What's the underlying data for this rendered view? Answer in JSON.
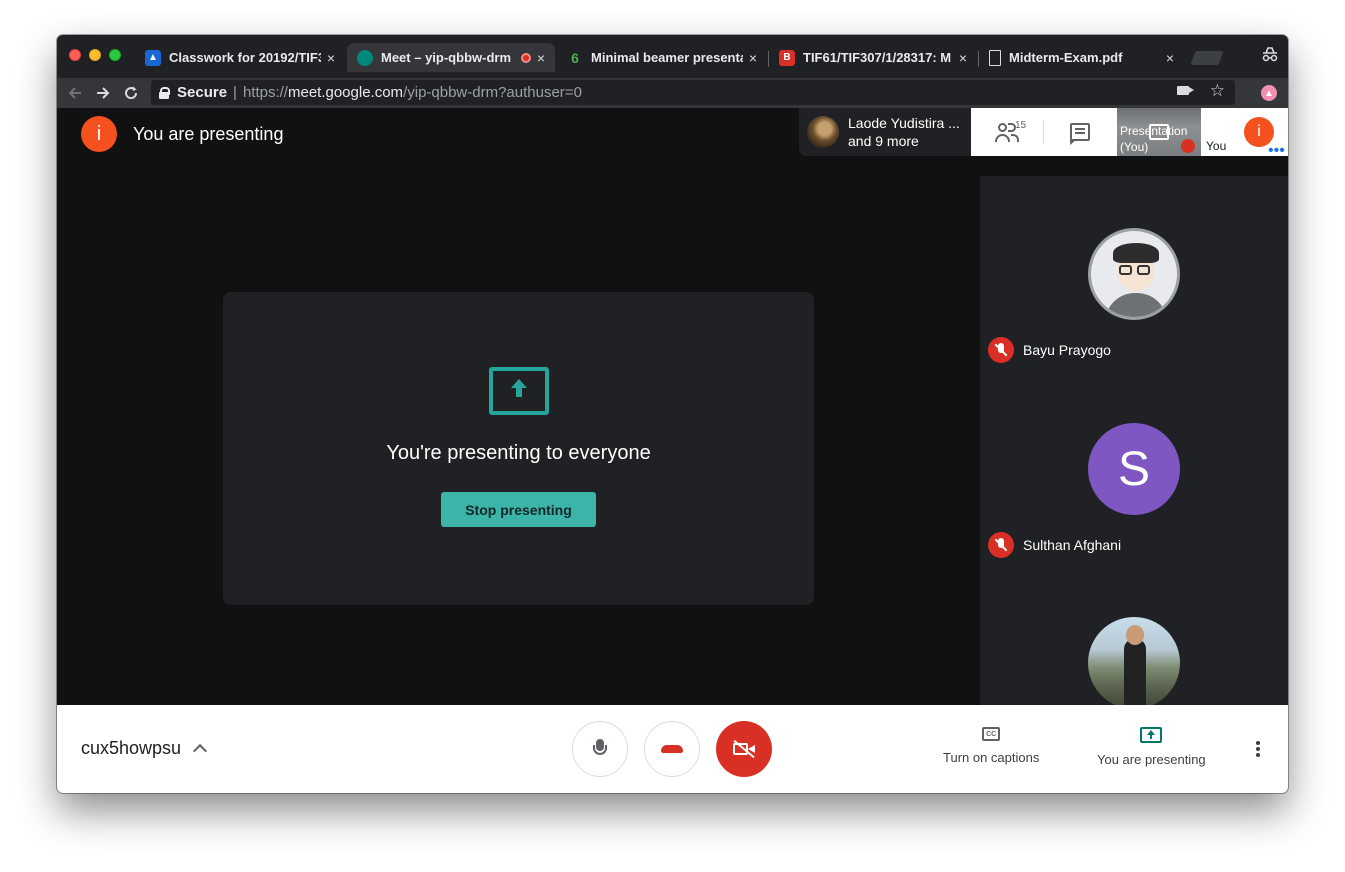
{
  "browser": {
    "tabs": [
      {
        "title": "Classwork for 20192/TIF3",
        "favicon_color": "#1967d2"
      },
      {
        "title": "Meet – yip-qbbw-drm",
        "favicon_color": "#00897b",
        "active": true,
        "recording": true
      },
      {
        "title": "Minimal beamer presentati",
        "favicon_color": "#4caf50"
      },
      {
        "title": "TIF61/TIF307/1/28317: M",
        "favicon_color": "#d93025"
      },
      {
        "title": "Midterm-Exam.pdf",
        "favicon_color": "#dadce0"
      }
    ],
    "tab_close_glyph": "×",
    "address": {
      "secure_label": "Secure",
      "divider": "|",
      "scheme": "https://",
      "host": "meet.google.com",
      "path": "/yip-qbbw-drm?authuser=0"
    },
    "icons": {
      "back": "arrow-left-icon",
      "forward": "arrow-right-icon",
      "reload": "reload-icon",
      "star": "star-icon",
      "camera": "camera-icon",
      "incognito": "incognito-icon"
    }
  },
  "meet": {
    "presenting_badge": {
      "avatar_letter": "i",
      "label": "You are presenting"
    },
    "panel": {
      "message": "You're presenting to everyone",
      "stop_button": "Stop presenting"
    },
    "attendees_chip": {
      "line1": "Laode Yudistira ...",
      "line2": "and 9 more"
    },
    "people_count": "15",
    "presentation_tile": {
      "label": "Presentation (You)"
    },
    "self_tile": {
      "label": "You",
      "avatar_letter": "i",
      "dots": "•••"
    },
    "participants": [
      {
        "name": "Bayu Prayogo",
        "avatar": "cartoon",
        "muted": true
      },
      {
        "name": "Sulthan Afghani",
        "avatar": "letter",
        "letter": "S",
        "muted": true
      },
      {
        "name": "",
        "avatar": "photo",
        "muted": false
      }
    ],
    "bottom_bar": {
      "meeting_code": "cux5howpsu",
      "captions_label": "Turn on captions",
      "captions_icon_text": "CC",
      "presenting_label": "You are presenting"
    }
  },
  "colors": {
    "accent_teal": "#26a69a",
    "danger_red": "#d93025",
    "avatar_orange": "#f4511e",
    "avatar_purple": "#7e57c2"
  }
}
